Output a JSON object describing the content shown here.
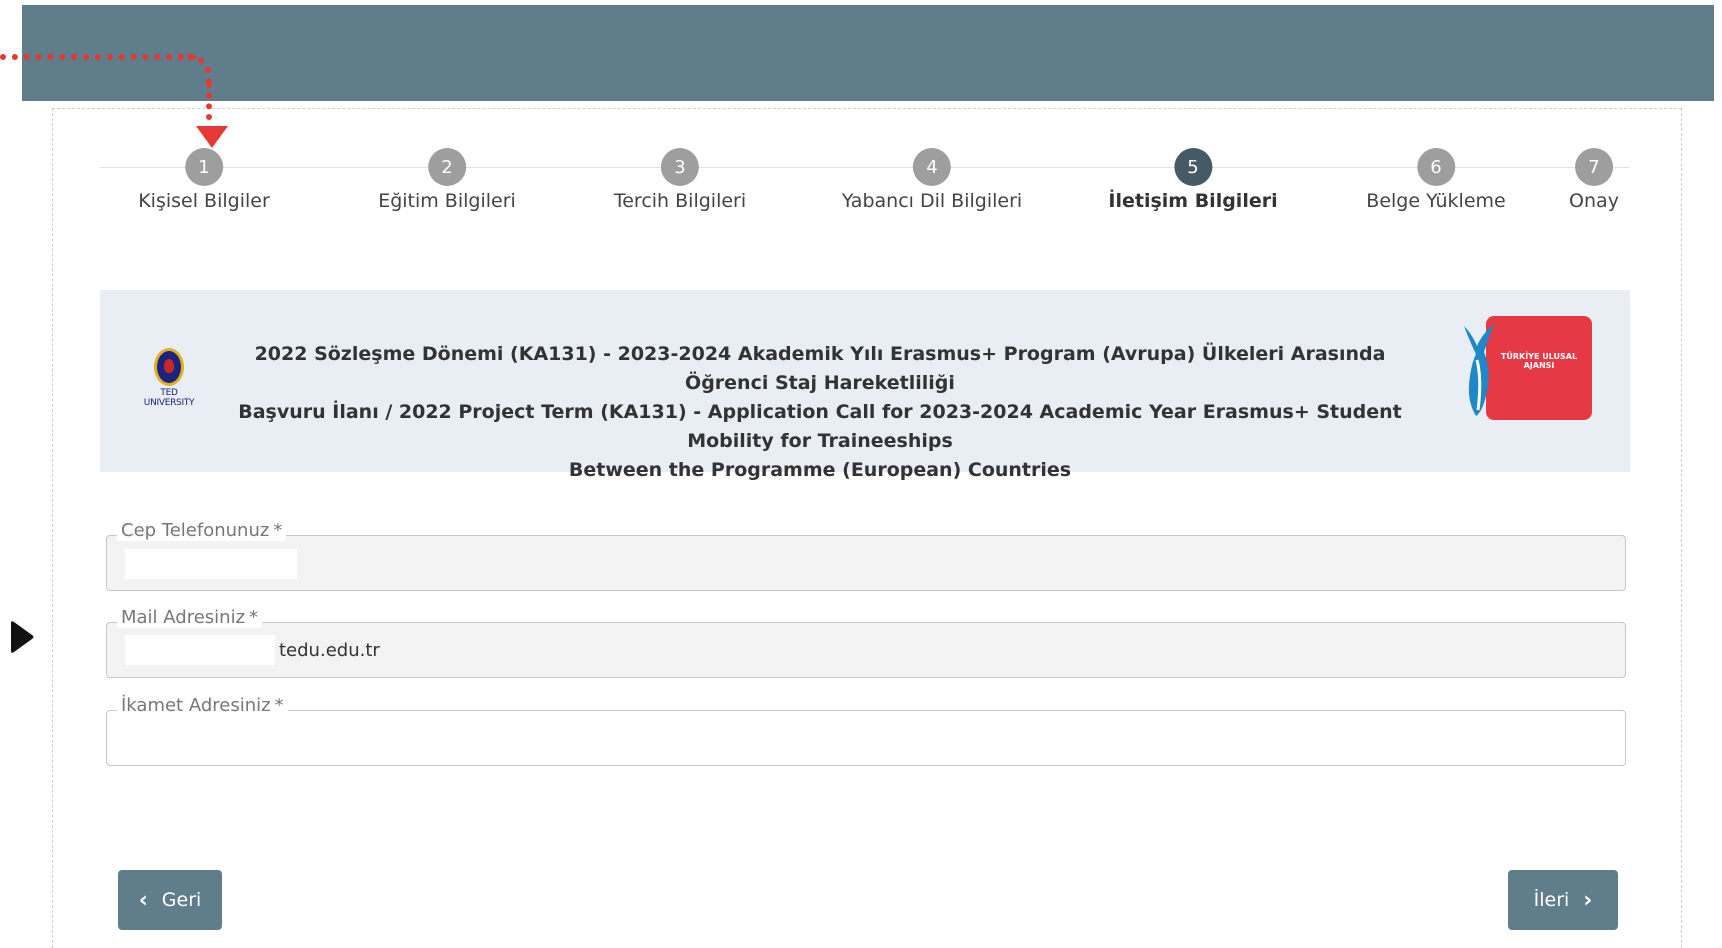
{
  "steps": [
    {
      "number": "1",
      "label": "Kişisel Bilgiler"
    },
    {
      "number": "2",
      "label": "Eğitim Bilgileri"
    },
    {
      "number": "3",
      "label": "Tercih Bilgileri"
    },
    {
      "number": "4",
      "label": "Yabancı Dil Bilgileri"
    },
    {
      "number": "5",
      "label": "İletişim Bilgileri"
    },
    {
      "number": "6",
      "label": "Belge Yükleme"
    },
    {
      "number": "7",
      "label": "Onay"
    }
  ],
  "active_step": "5",
  "banner": {
    "title_line1": "2022 Sözleşme Dönemi (KA131) - 2023-2024 Akademik Yılı Erasmus+ Program (Avrupa) Ülkeleri Arasında Öğrenci Staj Hareketliliği",
    "title_line2": "Başvuru İlanı / 2022 Project Term (KA131) - Application Call for 2023-2024 Academic Year Erasmus+ Student Mobility for Traineeships",
    "title_line3": "Between the Programme (European) Countries",
    "left_logo_text": "TED UNIVERSITY",
    "right_logo_text": "TÜRKİYE ULUSAL AJANSI"
  },
  "form": {
    "phone": {
      "label": "Cep Telefonunuz",
      "required": "*",
      "value": ""
    },
    "email": {
      "label": "Mail Adresiniz",
      "required": "*",
      "value": "tedu.edu.tr"
    },
    "address": {
      "label": "İkamet Adresiniz",
      "required": "*",
      "value": ""
    }
  },
  "buttons": {
    "back": "Geri",
    "next": "İleri"
  },
  "colors": {
    "header": "#607d8b",
    "annotation": "#e53935",
    "active_step": "#455a64",
    "inactive_step": "#9e9e9e"
  }
}
